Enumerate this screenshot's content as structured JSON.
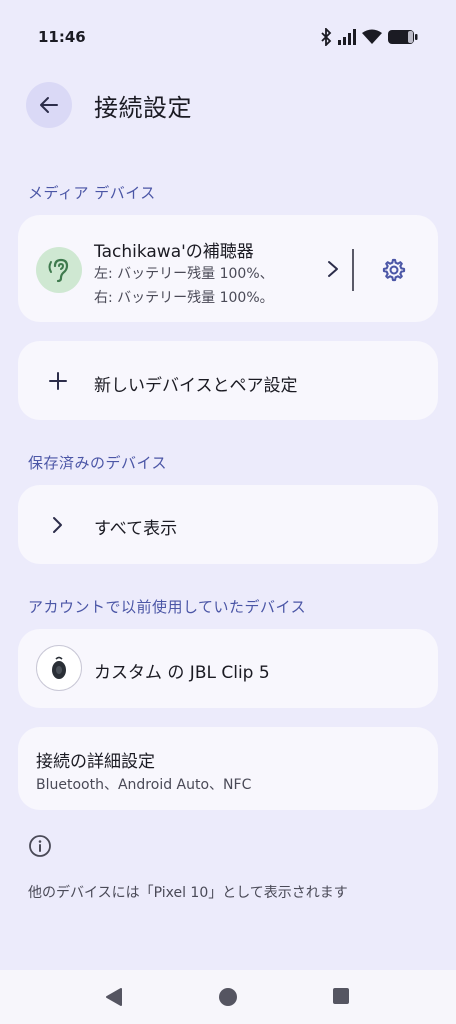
{
  "status_bar": {
    "time": "11:46",
    "icons": [
      "bluetooth-icon",
      "signal-icon",
      "wifi-icon",
      "battery-icon"
    ]
  },
  "header": {
    "title": "接続設定",
    "back_icon": "arrow-left-icon"
  },
  "sections": {
    "media": "メディア デバイス",
    "saved": "保存済みのデバイス",
    "account": "アカウントで以前使用していたデバイス"
  },
  "media_device": {
    "name": "Tachikawa'の補聴器",
    "left_battery": "左: バッテリー残量 100%、",
    "right_battery": "右: バッテリー残量 100%。"
  },
  "pair_new": {
    "label": "新しいデバイスとペア設定"
  },
  "show_all": {
    "label": "すべて表示"
  },
  "account_device": {
    "name": "カスタム の JBL Clip 5"
  },
  "advanced": {
    "title": "接続の詳細設定",
    "subtitle": "Bluetooth、Android Auto、NFC"
  },
  "footer": {
    "text": "他のデバイスには「Pixel 10」として表示されます"
  },
  "colors": {
    "background": "#ecebfb",
    "card": "#f8f7fd",
    "accent": "#4b56a6",
    "hearing_icon_bg": "#cfe8d2",
    "hearing_icon_fg": "#3f7a4e"
  }
}
